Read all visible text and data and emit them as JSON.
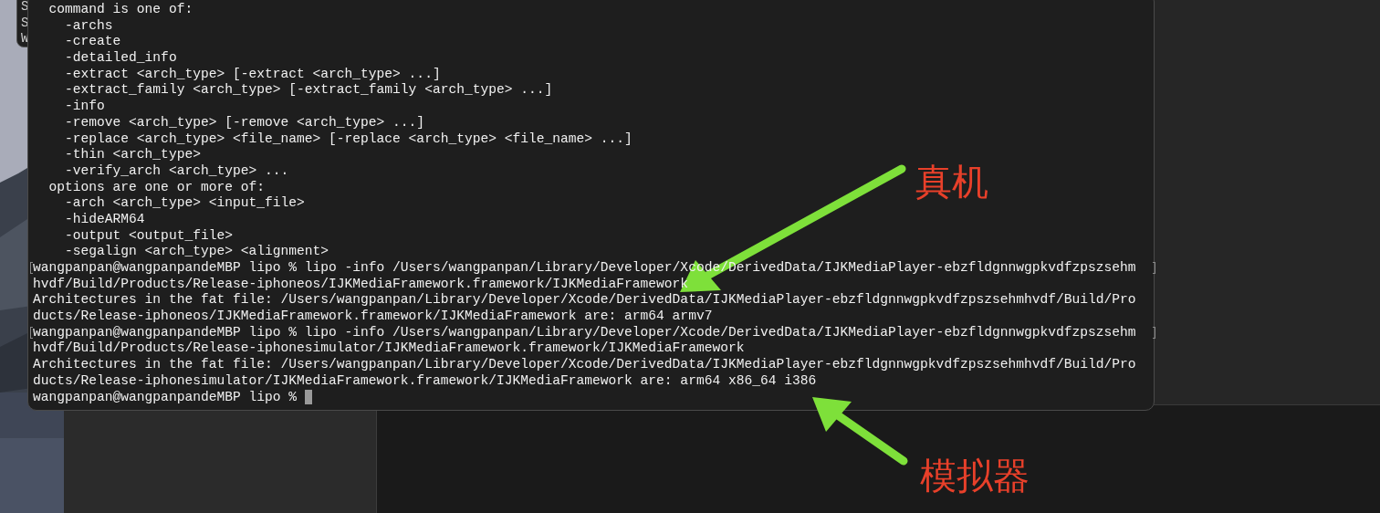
{
  "background_window": {
    "lines": [
      "S",
      "S",
      "W"
    ]
  },
  "terminal": {
    "lines": [
      {
        "text": "  command is one of:",
        "marked": false
      },
      {
        "text": "    -archs",
        "marked": false
      },
      {
        "text": "    -create",
        "marked": false
      },
      {
        "text": "    -detailed_info",
        "marked": false
      },
      {
        "text": "    -extract <arch_type> [-extract <arch_type> ...]",
        "marked": false
      },
      {
        "text": "    -extract_family <arch_type> [-extract_family <arch_type> ...]",
        "marked": false
      },
      {
        "text": "    -info",
        "marked": false
      },
      {
        "text": "    -remove <arch_type> [-remove <arch_type> ...]",
        "marked": false
      },
      {
        "text": "    -replace <arch_type> <file_name> [-replace <arch_type> <file_name> ...]",
        "marked": false
      },
      {
        "text": "    -thin <arch_type>",
        "marked": false
      },
      {
        "text": "    -verify_arch <arch_type> ...",
        "marked": false
      },
      {
        "text": "  options are one or more of:",
        "marked": false
      },
      {
        "text": "    -arch <arch_type> <input_file>",
        "marked": false
      },
      {
        "text": "    -hideARM64",
        "marked": false
      },
      {
        "text": "    -output <output_file>",
        "marked": false
      },
      {
        "text": "    -segalign <arch_type> <alignment>",
        "marked": false
      },
      {
        "text": "wangpanpan@wangpanpandeMBP lipo % lipo -info /Users/wangpanpan/Library/Developer/Xcode/DerivedData/IJKMediaPlayer-ebzfldgnnwgpkvdfzpszsehm",
        "marked": true
      },
      {
        "text": "hvdf/Build/Products/Release-iphoneos/IJKMediaFramework.framework/IJKMediaFramework",
        "marked": false
      },
      {
        "text": "Architectures in the fat file: /Users/wangpanpan/Library/Developer/Xcode/DerivedData/IJKMediaPlayer-ebzfldgnnwgpkvdfzpszsehmhvdf/Build/Pro",
        "marked": false
      },
      {
        "text": "ducts/Release-iphoneos/IJKMediaFramework.framework/IJKMediaFramework are: arm64 armv7",
        "marked": false
      },
      {
        "text": "wangpanpan@wangpanpandeMBP lipo % lipo -info /Users/wangpanpan/Library/Developer/Xcode/DerivedData/IJKMediaPlayer-ebzfldgnnwgpkvdfzpszsehm",
        "marked": true
      },
      {
        "text": "hvdf/Build/Products/Release-iphonesimulator/IJKMediaFramework.framework/IJKMediaFramework",
        "marked": false
      },
      {
        "text": "Architectures in the fat file: /Users/wangpanpan/Library/Developer/Xcode/DerivedData/IJKMediaPlayer-ebzfldgnnwgpkvdfzpszsehmhvdf/Build/Pro",
        "marked": false
      },
      {
        "text": "ducts/Release-iphonesimulator/IJKMediaFramework.framework/IJKMediaFramework are: arm64 x86_64 i386",
        "marked": false
      }
    ],
    "prompt": "wangpanpan@wangpanpandeMBP lipo % "
  },
  "annotations": [
    {
      "label": "真机"
    },
    {
      "label": "模拟器"
    }
  ]
}
